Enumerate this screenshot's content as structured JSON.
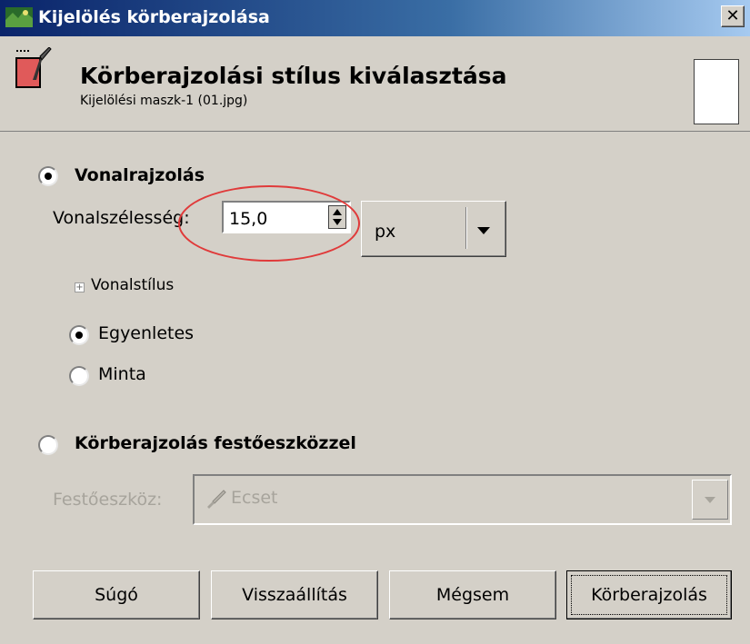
{
  "window": {
    "title": "Kijelölés körberajzolása",
    "close_glyph": "✕"
  },
  "header": {
    "title": "Körberajzolási stílus kiválasztása",
    "subtitle": "Kijelölési maszk-1 (01.jpg)"
  },
  "line": {
    "radio_label": "Vonalrajzolás",
    "width_label": "Vonalszélesség:",
    "width_value": "15,0",
    "unit": "px",
    "style_expander_label": "Vonalstílus",
    "solid_label": "Egyenletes",
    "pattern_label": "Minta"
  },
  "paint": {
    "radio_label": "Körberajzolás festőeszközzel",
    "tool_label": "Festőeszköz:",
    "tool_value": "Ecset"
  },
  "buttons": {
    "help": "Súgó",
    "reset": "Visszaállítás",
    "cancel": "Mégsem",
    "stroke": "Körberajzolás"
  },
  "colors": {
    "titlebar_start": "#0a246a",
    "window_bg": "#d4d0c8",
    "highlight": "#e03a3a"
  },
  "icons": [
    "gimp-app-icon",
    "stroke-selection-icon",
    "spin-up-icon",
    "spin-down-icon",
    "dropdown-arrow-icon",
    "expander-plus-icon",
    "brush-icon",
    "close-icon"
  ]
}
